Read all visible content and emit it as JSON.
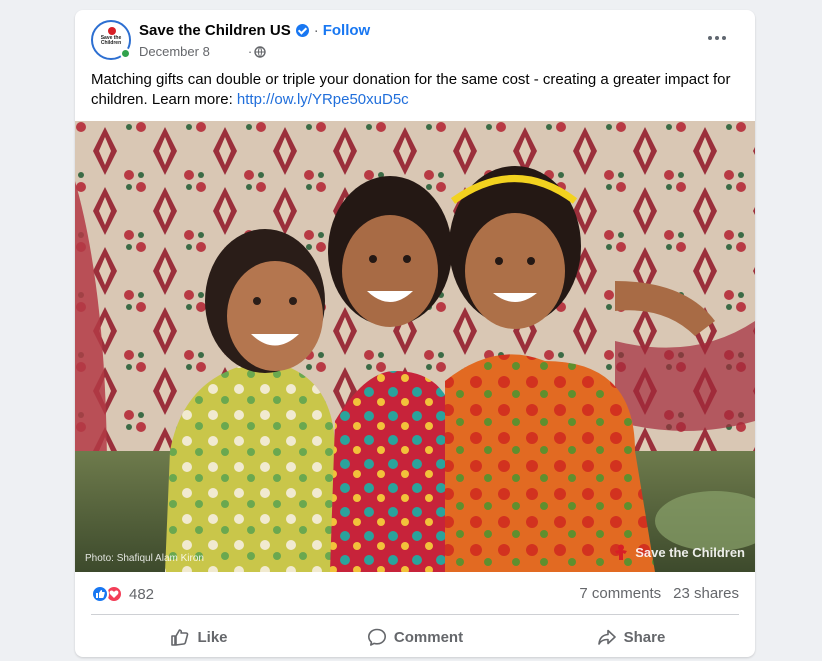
{
  "post": {
    "page_name": "Save the Children US",
    "follow_label": "Follow",
    "separator": "·",
    "date": "December 8",
    "meta_separator": "·",
    "avatar_text": "Save the Children",
    "text": "Matching gifts can double or triple your donation for the same cost - creating a greater impact for children. Learn more: ",
    "link": "http://ow.ly/YRpe50xuD5c",
    "photo_credit": "Photo: Shafiqul Alam Kiron",
    "photo_brand": "Save the Children",
    "icons": {
      "verified": "verified-badge-icon",
      "privacy": "globe-icon",
      "menu": "more-options-icon"
    }
  },
  "stats": {
    "reaction_count": "482",
    "comments": "7 comments",
    "shares": "23 shares",
    "reaction_icons": [
      "like-reaction-icon",
      "love-reaction-icon"
    ]
  },
  "actions": [
    {
      "label": "Like",
      "icon": "thumbs-up-icon"
    },
    {
      "label": "Comment",
      "icon": "comment-bubble-icon"
    },
    {
      "label": "Share",
      "icon": "share-arrow-icon"
    }
  ],
  "colors": {
    "brand_blue": "#1877f2",
    "link_blue": "#216fdb",
    "love_red": "#f33e58",
    "save_children_red": "#d71f26",
    "secondary_text": "#65676b"
  }
}
